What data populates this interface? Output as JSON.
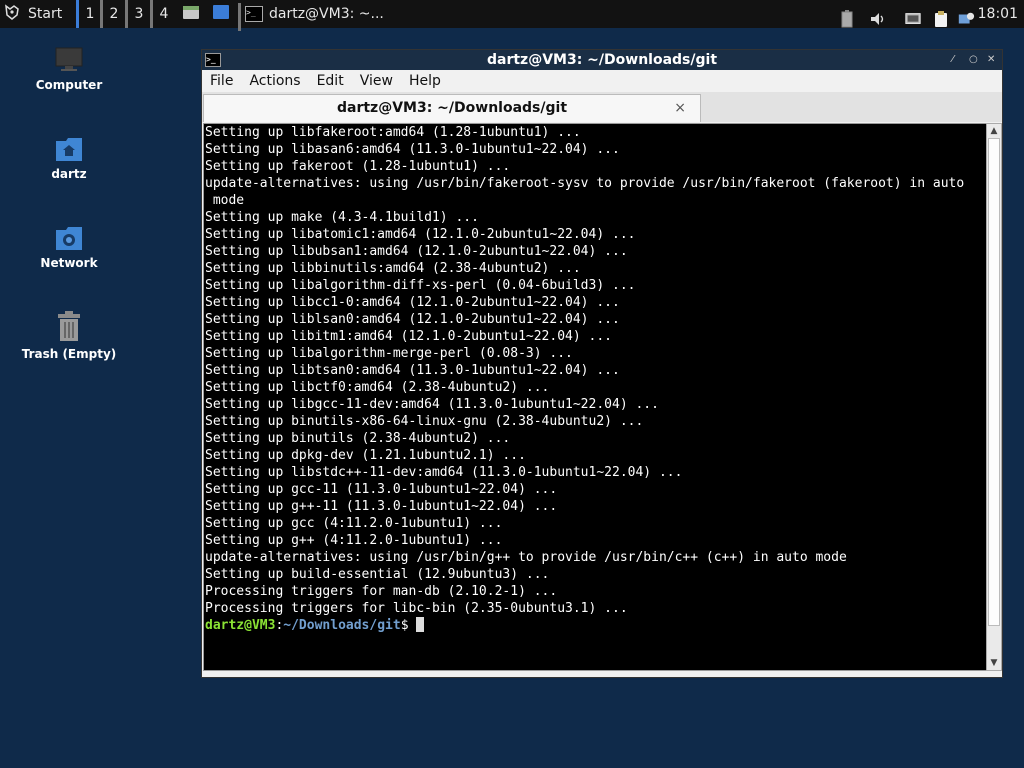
{
  "taskbar": {
    "start_label": "Start",
    "workspaces": [
      "1",
      "2",
      "3",
      "4"
    ],
    "task_label": "dartz@VM3: ~...",
    "clock": "18:01"
  },
  "desktop": {
    "icons": [
      {
        "label": "Computer",
        "icon": "computer-icon"
      },
      {
        "label": "dartz",
        "icon": "home-folder-icon"
      },
      {
        "label": "Network",
        "icon": "network-folder-icon"
      },
      {
        "label": "Trash (Empty)",
        "icon": "trash-icon"
      }
    ]
  },
  "window": {
    "title": "dartz@VM3: ~/Downloads/git",
    "menu": [
      "File",
      "Actions",
      "Edit",
      "View",
      "Help"
    ],
    "tab_title": "dartz@VM3: ~/Downloads/git",
    "tab_close": "×",
    "terminal_lines": [
      "Setting up libfakeroot:amd64 (1.28-1ubuntu1) ...",
      "Setting up libasan6:amd64 (11.3.0-1ubuntu1~22.04) ...",
      "Setting up fakeroot (1.28-1ubuntu1) ...",
      "update-alternatives: using /usr/bin/fakeroot-sysv to provide /usr/bin/fakeroot (fakeroot) in auto",
      " mode",
      "Setting up make (4.3-4.1build1) ...",
      "Setting up libatomic1:amd64 (12.1.0-2ubuntu1~22.04) ...",
      "Setting up libubsan1:amd64 (12.1.0-2ubuntu1~22.04) ...",
      "Setting up libbinutils:amd64 (2.38-4ubuntu2) ...",
      "Setting up libalgorithm-diff-xs-perl (0.04-6build3) ...",
      "Setting up libcc1-0:amd64 (12.1.0-2ubuntu1~22.04) ...",
      "Setting up liblsan0:amd64 (12.1.0-2ubuntu1~22.04) ...",
      "Setting up libitm1:amd64 (12.1.0-2ubuntu1~22.04) ...",
      "Setting up libalgorithm-merge-perl (0.08-3) ...",
      "Setting up libtsan0:amd64 (11.3.0-1ubuntu1~22.04) ...",
      "Setting up libctf0:amd64 (2.38-4ubuntu2) ...",
      "Setting up libgcc-11-dev:amd64 (11.3.0-1ubuntu1~22.04) ...",
      "Setting up binutils-x86-64-linux-gnu (2.38-4ubuntu2) ...",
      "Setting up binutils (2.38-4ubuntu2) ...",
      "Setting up dpkg-dev (1.21.1ubuntu2.1) ...",
      "Setting up libstdc++-11-dev:amd64 (11.3.0-1ubuntu1~22.04) ...",
      "Setting up gcc-11 (11.3.0-1ubuntu1~22.04) ...",
      "Setting up g++-11 (11.3.0-1ubuntu1~22.04) ...",
      "Setting up gcc (4:11.2.0-1ubuntu1) ...",
      "Setting up g++ (4:11.2.0-1ubuntu1) ...",
      "update-alternatives: using /usr/bin/g++ to provide /usr/bin/c++ (c++) in auto mode",
      "Setting up build-essential (12.9ubuntu3) ...",
      "Processing triggers for man-db (2.10.2-1) ...",
      "Processing triggers for libc-bin (2.35-0ubuntu3.1) ..."
    ],
    "prompt": {
      "user": "dartz@VM3",
      "colon": ":",
      "path": "~/Downloads/git",
      "symbol": "$ "
    }
  },
  "colors": {
    "desktop_bg": "#0f2a4a",
    "taskbar_bg": "#121212",
    "titlebar_bg": "#1a2e45",
    "prompt_user": "#8ae234",
    "prompt_path": "#729fcf"
  }
}
